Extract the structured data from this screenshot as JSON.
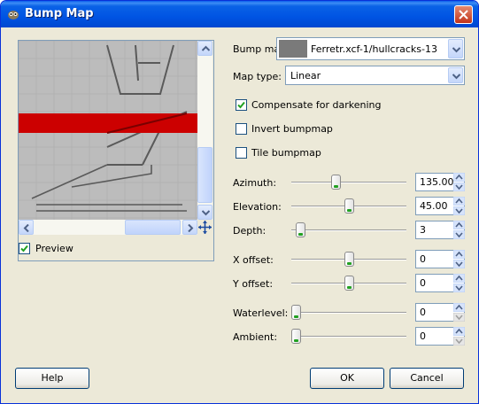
{
  "window": {
    "title": "Bump Map"
  },
  "preview": {
    "label": "Preview",
    "checked": true
  },
  "bump_map": {
    "label": "Bump map:",
    "value": "Ferretr.xcf-1/hullcracks-13"
  },
  "map_type": {
    "label": "Map type:",
    "value": "Linear"
  },
  "options": {
    "compensate": {
      "label": "Compensate for darkening",
      "checked": true
    },
    "invert": {
      "label": "Invert bumpmap",
      "checked": false
    },
    "tile": {
      "label": "Tile bumpmap",
      "checked": false
    }
  },
  "sliders": {
    "azimuth": {
      "label": "Azimuth:",
      "value": "135.00",
      "fraction": 0.375
    },
    "elevation": {
      "label": "Elevation:",
      "value": "45.00",
      "fraction": 0.5
    },
    "depth": {
      "label": "Depth:",
      "value": "3",
      "fraction": 0.04
    },
    "x_offset": {
      "label": "X offset:",
      "value": "0",
      "fraction": 0.5
    },
    "y_offset": {
      "label": "Y offset:",
      "value": "0",
      "fraction": 0.5
    },
    "waterlevel": {
      "label": "Waterlevel:",
      "value": "0",
      "fraction": 0.0
    },
    "ambient": {
      "label": "Ambient:",
      "value": "0",
      "fraction": 0.0
    }
  },
  "buttons": {
    "help": "Help",
    "ok": "OK",
    "cancel": "Cancel"
  },
  "colors": {
    "title_bar": "#0054e3",
    "dialog_bg": "#ece9d8",
    "preview_stripe": "#cc0000",
    "slider_green": "#21a121"
  }
}
